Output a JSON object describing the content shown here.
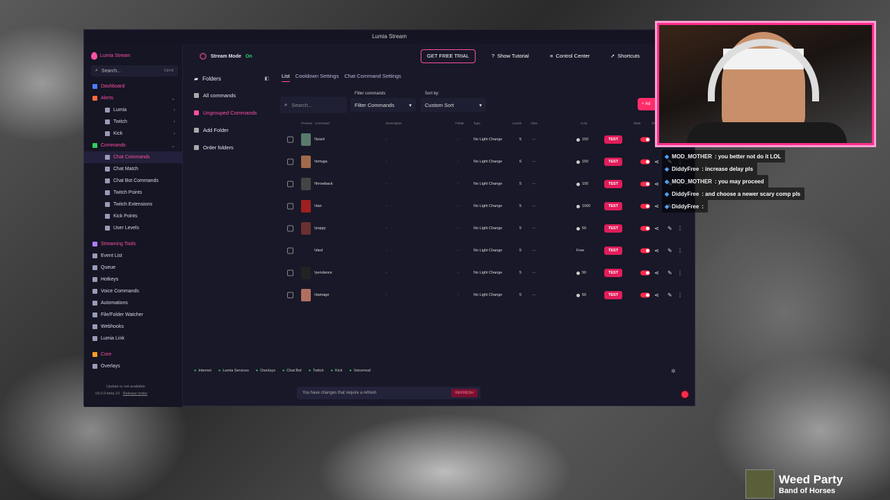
{
  "window": {
    "title": "Lumia Stream"
  },
  "sidebar": {
    "brand": "Lumia Stream",
    "search_placeholder": "Search...",
    "search_shortcut": "Ctrl+K",
    "items": [
      {
        "label": "Dashboard",
        "type": "sec"
      },
      {
        "label": "Alerts",
        "type": "sec"
      },
      {
        "label": "Lumia",
        "type": "sub"
      },
      {
        "label": "Twitch",
        "type": "sub"
      },
      {
        "label": "Kick",
        "type": "sub"
      },
      {
        "label": "Commands",
        "type": "sec"
      },
      {
        "label": "Chat Commands",
        "type": "sub"
      },
      {
        "label": "Chat Match",
        "type": "sub"
      },
      {
        "label": "Chat Bot Commands",
        "type": "sub"
      },
      {
        "label": "Twitch Points",
        "type": "sub"
      },
      {
        "label": "Twitch Extensions",
        "type": "sub"
      },
      {
        "label": "Kick Points",
        "type": "sub"
      },
      {
        "label": "User Levels",
        "type": "sub"
      },
      {
        "label": "Streaming Tools",
        "type": "sec"
      },
      {
        "label": "Event List",
        "type": "item"
      },
      {
        "label": "Queue",
        "type": "item"
      },
      {
        "label": "Hotkeys",
        "type": "item"
      },
      {
        "label": "Voice Commands",
        "type": "item"
      },
      {
        "label": "Automations",
        "type": "item"
      },
      {
        "label": "File/Folder Watcher",
        "type": "item"
      },
      {
        "label": "Webhooks",
        "type": "item"
      },
      {
        "label": "Lumia Link",
        "type": "item"
      },
      {
        "label": "Core",
        "type": "sec"
      },
      {
        "label": "Overlays",
        "type": "item"
      }
    ],
    "update": "Update is not available",
    "version": "v9.0.0-beta 10",
    "release_notes": "Release notes"
  },
  "topbar": {
    "stream_mode": "Stream Mode",
    "stream_state": "On",
    "trial": "GET FREE TRIAL",
    "tutorial": "Show Tutorial",
    "control": "Control Center",
    "shortcuts": "Shortcuts"
  },
  "folders": {
    "header": "Folders",
    "items": [
      "All commands",
      "Ungrouped Commands",
      "Add Folder",
      "Order folders"
    ]
  },
  "tabs": [
    "List",
    "Cooldown Settings",
    "Chat Command Settings"
  ],
  "filters": {
    "search_placeholder": "Search...",
    "filter_label": "Filter commands",
    "filter_value": "Filter Commands",
    "sort_label": "Sort by:",
    "sort_value": "Custom Sort",
    "add": "Ad"
  },
  "table": {
    "headers": [
      "Preview",
      "Command",
      "Description",
      "Folder",
      "Type",
      "Levels",
      "Alias",
      "Cost",
      "State",
      "Sh"
    ],
    "rows": [
      {
        "cmd": "!lizard",
        "desc": "-",
        "folder": "-",
        "type": "No Light Change",
        "levels": "5",
        "alias": "—",
        "cost": "150",
        "test": "TEST",
        "thumb": "#5a7a6a"
      },
      {
        "cmd": "!tortuga",
        "desc": "-",
        "folder": "-",
        "type": "No Light Change",
        "levels": "6",
        "alias": "—",
        "cost": "150",
        "test": "TEST",
        "thumb": "#a06a4a"
      },
      {
        "cmd": "!throwback",
        "desc": "-",
        "folder": "-",
        "type": "No Light Change",
        "levels": "5",
        "alias": "—",
        "cost": "100",
        "test": "TEST",
        "thumb": "#444"
      },
      {
        "cmd": "!dan",
        "desc": "-",
        "folder": "-",
        "type": "No Light Change",
        "levels": "5",
        "alias": "—",
        "cost": "1000",
        "test": "TEST",
        "thumb": "#a02020"
      },
      {
        "cmd": "!poppy",
        "desc": "-",
        "folder": "-",
        "type": "No Light Change",
        "levels": "5",
        "alias": "—",
        "cost": "50",
        "test": "TEST",
        "thumb": "#6a3030"
      },
      {
        "cmd": "!died",
        "desc": "-",
        "folder": "-",
        "type": "No Light Change",
        "levels": "5",
        "alias": "—",
        "cost": "Free",
        "test": "TEST",
        "thumb": "#181828"
      },
      {
        "cmd": "!pendance",
        "desc": "-",
        "folder": "-",
        "type": "No Light Change",
        "levels": "5",
        "alias": "—",
        "cost": "50",
        "test": "TEST",
        "thumb": "#222"
      },
      {
        "cmd": "!damage",
        "desc": "-",
        "folder": "-",
        "type": "No Light Change",
        "levels": "5",
        "alias": "—",
        "cost": "50",
        "test": "TEST",
        "thumb": "#b07060"
      }
    ]
  },
  "status": [
    "Internet",
    "Lumia Services",
    "Overlays",
    "Chat Bot",
    "Twitch",
    "Kick",
    "Voicemod"
  ],
  "notice": {
    "text": "You have changes that require a refresh",
    "button": "REFRESH"
  },
  "chat": [
    {
      "user": "MOD_MOTHER",
      "msg": ": you better not do it LOL"
    },
    {
      "user": "DiddyFree",
      "msg": ": increase delay pls"
    },
    {
      "user": "MOD_MOTHER",
      "msg": ": you may proceed"
    },
    {
      "user": "DiddyFree",
      "msg": ": and choose a newer scary comp pls"
    },
    {
      "user": "DiddyFree",
      "msg": ":"
    }
  ],
  "nowplaying": {
    "title": "Weed Party",
    "artist": "Band of Horses"
  }
}
